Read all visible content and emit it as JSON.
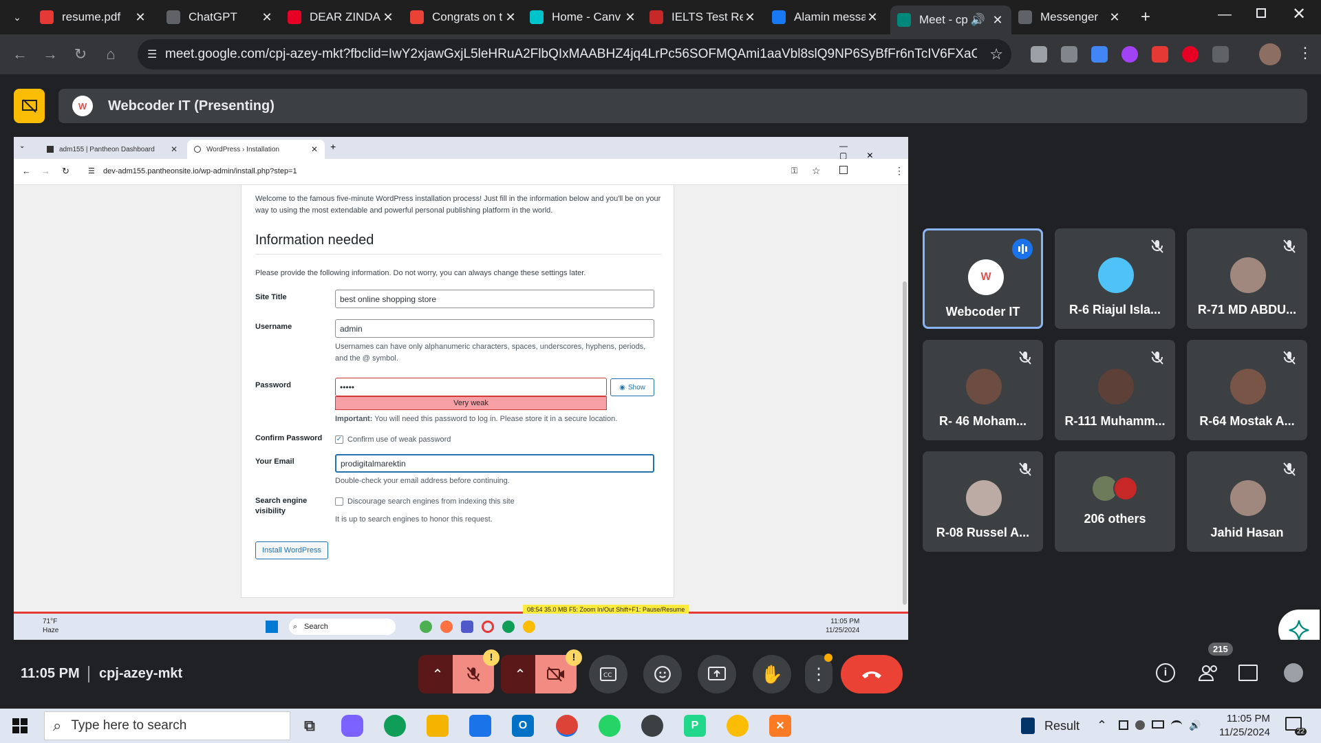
{
  "browser": {
    "tabs": [
      {
        "title": "resume.pdf",
        "icon": "pdf-icon",
        "color": "#e53935"
      },
      {
        "title": "ChatGPT",
        "icon": "chatgpt-icon",
        "color": "#5f6368"
      },
      {
        "title": "DEAR ZINDA(",
        "icon": "pinterest-icon",
        "color": "#e60023"
      },
      {
        "title": "Congrats on t",
        "icon": "gmail-icon",
        "color": "#ea4335"
      },
      {
        "title": "Home - Canv",
        "icon": "canva-icon",
        "color": "#00c4cc"
      },
      {
        "title": "IELTS Test Rep",
        "icon": "ielts-icon",
        "color": "#c62828"
      },
      {
        "title": "Alamin messa",
        "icon": "facebook-icon",
        "color": "#1877f2"
      },
      {
        "title": "Meet - cp",
        "icon": "meet-icon",
        "color": "#00897b"
      },
      {
        "title": "Messenger",
        "icon": "messenger-icon",
        "color": "#5f6368"
      }
    ],
    "url": "meet.google.com/cpj-azey-mkt?fbclid=IwY2xjawGxjL5leHRuA2FlbQIxMAABHZ4jq4LrPc56SOFMQAmi1aaVbl8slQ9NP6SyBfFr6nTcIV6FXaOi8ossbA_aem_..."
  },
  "meet": {
    "presenting_title": "Webcoder IT (Presenting)",
    "time": "11:05 PM",
    "meeting_code": "cpj-azey-mkt",
    "participant_count": "215",
    "participants": [
      {
        "name": "Webcoder IT",
        "speaking": true,
        "muted": false
      },
      {
        "name": "R-6 Riajul Isla...",
        "muted": true
      },
      {
        "name": "R-71 MD ABDU...",
        "muted": true
      },
      {
        "name": "R- 46 Moham...",
        "muted": true
      },
      {
        "name": "R-111 Muhamm...",
        "muted": true
      },
      {
        "name": "R-64 Mostak A...",
        "muted": true
      },
      {
        "name": "R-08 Russel A...",
        "muted": true
      },
      {
        "name": "206 others",
        "muted": false
      },
      {
        "name": "Jahid Hasan",
        "muted": true
      }
    ],
    "colors": {
      "end_call": "#ea4335",
      "muted_bg": "#f28b82",
      "speaking_border": "#8ab4f8"
    }
  },
  "shared_screen": {
    "tabs": [
      "adm155 | Pantheon Dashboard",
      "WordPress › Installation"
    ],
    "url": "dev-adm155.pantheonsite.io/wp-admin/install.php?step=1",
    "intro": "Welcome to the famous five-minute WordPress installation process! Just fill in the information below and you'll be on your way to using the most extendable and powerful personal publishing platform in the world.",
    "heading": "Information needed",
    "subtext": "Please provide the following information. Do not worry, you can always change these settings later.",
    "fields": {
      "site_title_label": "Site Title",
      "site_title_value": "best online shopping store",
      "username_label": "Username",
      "username_value": "admin",
      "username_help": "Usernames can have only alphanumeric characters, spaces, underscores, hyphens, periods, and the @ symbol.",
      "password_label": "Password",
      "password_value": "•••••",
      "show_label": "Show",
      "strength": "Very weak",
      "important_label": "Important:",
      "important_text": "You will need this password to log in. Please store it in a secure location.",
      "confirm_label": "Confirm Password",
      "confirm_text": "Confirm use of weak password",
      "email_label": "Your Email",
      "email_value": "prodigitalmarektin",
      "email_help": "Double-check your email address before continuing.",
      "search_label": "Search engine visibility",
      "search_text": "Discourage search engines from indexing this site",
      "search_help": "It is up to search engines to honor this request.",
      "install_button": "Install WordPress"
    },
    "recorder": "08:54   35.0 MB   F5: Zoom In/Out   Shift+F1: Pause/Resume",
    "taskbar": {
      "weather": "71°F",
      "weather_desc": "Haze",
      "search": "Search",
      "time": "11:05 PM",
      "date": "11/25/2024"
    }
  },
  "windows": {
    "search_placeholder": "Type here to search",
    "result_label": "Result",
    "time": "11:05 PM",
    "date": "11/25/2024",
    "notifications": "22"
  }
}
